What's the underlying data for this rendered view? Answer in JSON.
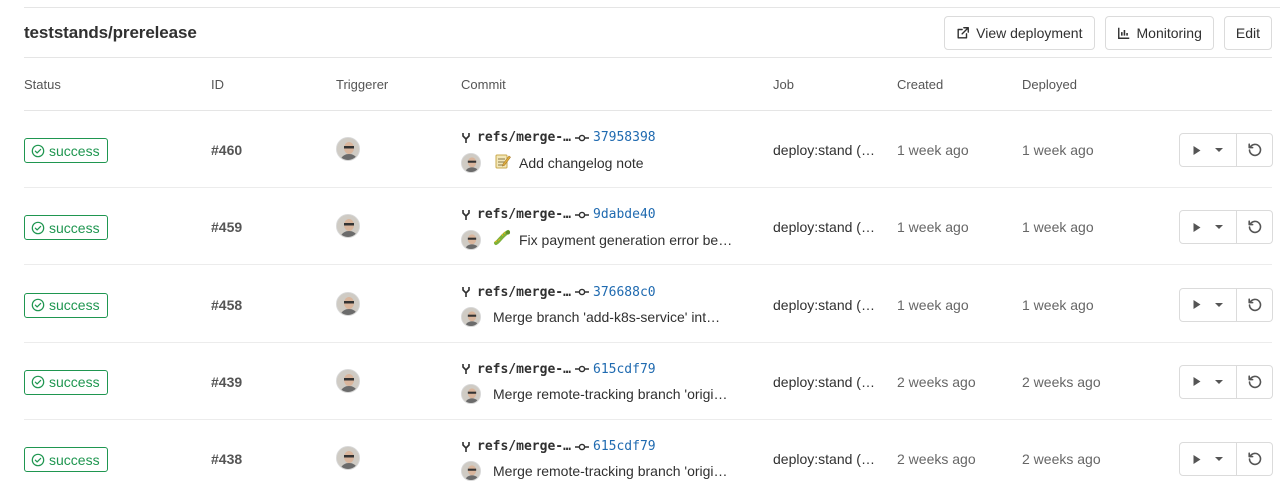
{
  "header": {
    "title": "teststands/prerelease",
    "view_deployment_label": "View deployment",
    "monitoring_label": "Monitoring",
    "edit_label": "Edit"
  },
  "columns": {
    "status": "Status",
    "id": "ID",
    "triggerer": "Triggerer",
    "commit": "Commit",
    "job": "Job",
    "created": "Created",
    "deployed": "Deployed"
  },
  "colors": {
    "success": "#1f9650",
    "sha": "#1f6ab0",
    "border": "#dbdbdb"
  },
  "rows": [
    {
      "status": "success",
      "id": "#460",
      "ref": "refs/merge-…",
      "sha": "37958398",
      "emoji": "memo",
      "message": "Add changelog note",
      "job": "deploy:stand (…",
      "created": "1 week ago",
      "deployed": "1 week ago"
    },
    {
      "status": "success",
      "id": "#459",
      "ref": "refs/merge-…",
      "sha": "9dabde40",
      "emoji": "bug",
      "message": "Fix payment generation error be…",
      "job": "deploy:stand (…",
      "created": "1 week ago",
      "deployed": "1 week ago"
    },
    {
      "status": "success",
      "id": "#458",
      "ref": "refs/merge-…",
      "sha": "376688c0",
      "emoji": "",
      "message": "Merge branch 'add-k8s-service' int…",
      "job": "deploy:stand (…",
      "created": "1 week ago",
      "deployed": "1 week ago"
    },
    {
      "status": "success",
      "id": "#439",
      "ref": "refs/merge-…",
      "sha": "615cdf79",
      "emoji": "",
      "message": "Merge remote-tracking branch 'origi…",
      "job": "deploy:stand (…",
      "created": "2 weeks ago",
      "deployed": "2 weeks ago"
    },
    {
      "status": "success",
      "id": "#438",
      "ref": "refs/merge-…",
      "sha": "615cdf79",
      "emoji": "",
      "message": "Merge remote-tracking branch 'origi…",
      "job": "deploy:stand (…",
      "created": "2 weeks ago",
      "deployed": "2 weeks ago"
    }
  ]
}
